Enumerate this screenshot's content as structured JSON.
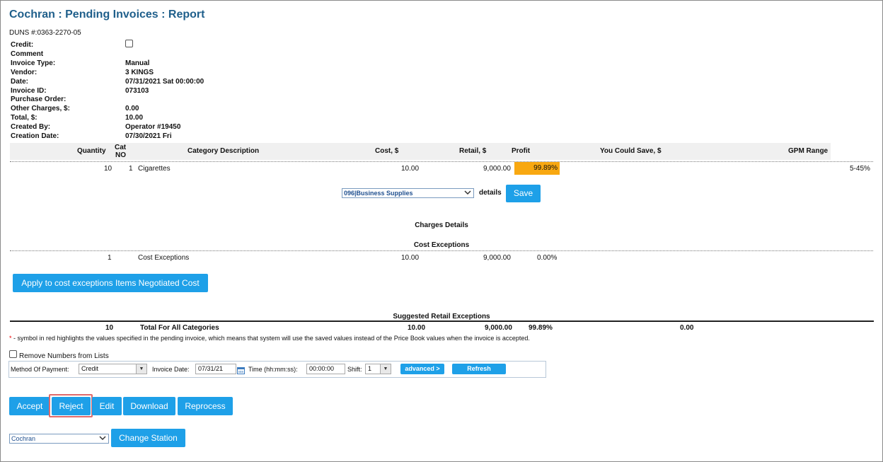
{
  "page": {
    "title": "Cochran : Pending Invoices : Report",
    "duns": "DUNS #:0363-2270-05"
  },
  "info": {
    "credit_label": "Credit:",
    "comment_label": "Comment",
    "invoice_type_label": "Invoice Type:",
    "invoice_type_value": "Manual",
    "vendor_label": "Vendor:",
    "vendor_value": "3 KINGS",
    "date_label": "Date:",
    "date_value": "07/31/2021 Sat 00:00:00",
    "invoice_id_label": "Invoice ID:",
    "invoice_id_value": "073103",
    "purchase_order_label": "Purchase Order:",
    "other_charges_label": "Other Charges, $:",
    "other_charges_value": "0.00",
    "total_label": "Total, $:",
    "total_value": "10.00",
    "created_by_label": "Created By:",
    "created_by_value": "Operator #19450",
    "creation_date_label": "Creation Date:",
    "creation_date_value": "07/30/2021 Fri"
  },
  "table": {
    "headers": {
      "quantity": "Quantity",
      "cat_no_line1": "Cat",
      "cat_no_line2": "NO",
      "category_description": "Category Description",
      "cost": "Cost, $",
      "retail": "Retail, $",
      "profit": "Profit",
      "you_could_save": "You Could Save, $",
      "gpm_range": "GPM Range"
    },
    "row": {
      "quantity": "10",
      "cat_no": "1",
      "description": "Cigarettes",
      "cost": "10.00",
      "retail": "9,000.00",
      "profit": "99.89%",
      "gpm_range": "5-45%"
    }
  },
  "category_select": {
    "value": "096|Business Supplies",
    "details_label": "details",
    "save_label": "Save"
  },
  "charges": {
    "title": "Charges Details",
    "cost_exceptions_title": "Cost Exceptions",
    "row": {
      "quantity": "1",
      "description": "Cost Exceptions",
      "cost": "10.00",
      "retail": "9,000.00",
      "profit": "0.00%"
    },
    "apply_button": "Apply to cost exceptions Items Negotiated Cost"
  },
  "suggested": {
    "title": "Suggested Retail Exceptions",
    "total": {
      "quantity": "10",
      "label": "Total For All Categories",
      "cost": "10.00",
      "retail": "9,000.00",
      "profit": "99.89%",
      "save": "0.00"
    },
    "note_symbol": "*",
    "note_text": " - symbol in red highlights the values specified in the pending invoice, which means that system will use the saved values instead of the Price Book values when the invoice is accepted."
  },
  "options": {
    "remove_numbers_label": "Remove Numbers from Lists",
    "method_of_payment_label": "Method Of Payment:",
    "method_of_payment_value": "Credit",
    "invoice_date_label": "Invoice Date:",
    "invoice_date_value": "07/31/21",
    "time_label": "Time (hh:mm:ss):",
    "time_value": "00:00:00",
    "shift_label": "Shift:",
    "shift_value": "1",
    "advanced_label": "advanced >",
    "refresh_label": "Refresh"
  },
  "actions": {
    "accept": "Accept",
    "reject": "Reject",
    "edit": "Edit",
    "download": "Download",
    "reprocess": "Reprocess"
  },
  "station": {
    "value": "Cochran",
    "change_label": "Change Station"
  },
  "colors": {
    "title": "#1f5f8b",
    "button": "#1ea0e8",
    "profit_highlight": "#f8a811",
    "reject_outline": "#e06a6a"
  }
}
